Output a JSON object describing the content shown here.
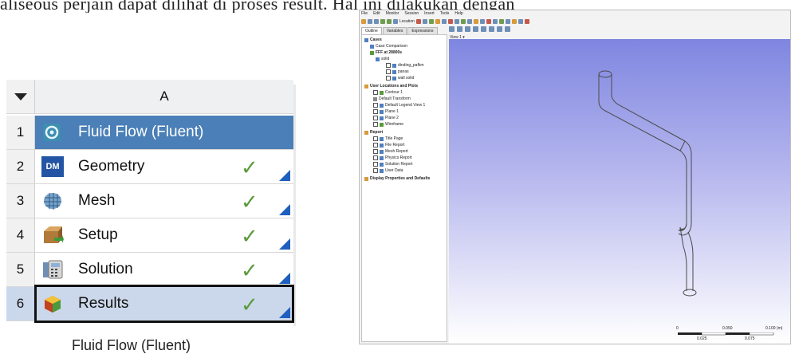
{
  "doc": {
    "top_line": "aliseous perjain dapat dilihat di proses result. Hal ini dilakukan dengan"
  },
  "workbench": {
    "column_header": "A",
    "rows": [
      {
        "num": "1",
        "label": "Fluid Flow (Fluent)",
        "icon": "fluent-icon"
      },
      {
        "num": "2",
        "label": "Geometry",
        "icon": "dm-icon",
        "icon_text": "DM"
      },
      {
        "num": "3",
        "label": "Mesh",
        "icon": "mesh-icon"
      },
      {
        "num": "4",
        "label": "Setup",
        "icon": "setup-icon"
      },
      {
        "num": "5",
        "label": "Solution",
        "icon": "solution-icon"
      },
      {
        "num": "6",
        "label": "Results",
        "icon": "results-icon"
      }
    ],
    "status_check": "✓",
    "caption": "Fluid Flow (Fluent)",
    "colors": {
      "title_bg": "#4a7fb7",
      "results_bg": "#cbd7ea",
      "check": "#5a9a3a",
      "triangle": "#1f5fbf"
    }
  },
  "cfd_post": {
    "menu": [
      "File",
      "Edit",
      "Monitor",
      "Session",
      "Insert",
      "Tools",
      "Help"
    ],
    "toolbar_location": "Location",
    "tabs": [
      "Outline",
      "Variables",
      "Expressions"
    ],
    "tree": {
      "cases": "Cases",
      "case_comparison": "Case Comparison",
      "fff": "FFF at 28800s",
      "solid": "solid",
      "solid_children": [
        "dinding_pafkm",
        "panas",
        "wall solid"
      ],
      "user_locations": "User Locations and Plots",
      "user_children": [
        "Contour 1",
        "Default Transform",
        "Default Legend View 1",
        "Plane 1",
        "Plane 2",
        "Wireframe"
      ],
      "report": "Report",
      "report_children": [
        "Title Page",
        "File Report",
        "Mesh Report",
        "Physics Report",
        "Solution Report",
        "User Data"
      ],
      "display": "Display Properties and Defaults"
    },
    "view_label": "View 1",
    "scale": {
      "ticks_top": [
        "0",
        "0.050",
        "0.100 (m)"
      ],
      "ticks_bottom": [
        "0.025",
        "0.075"
      ]
    }
  }
}
